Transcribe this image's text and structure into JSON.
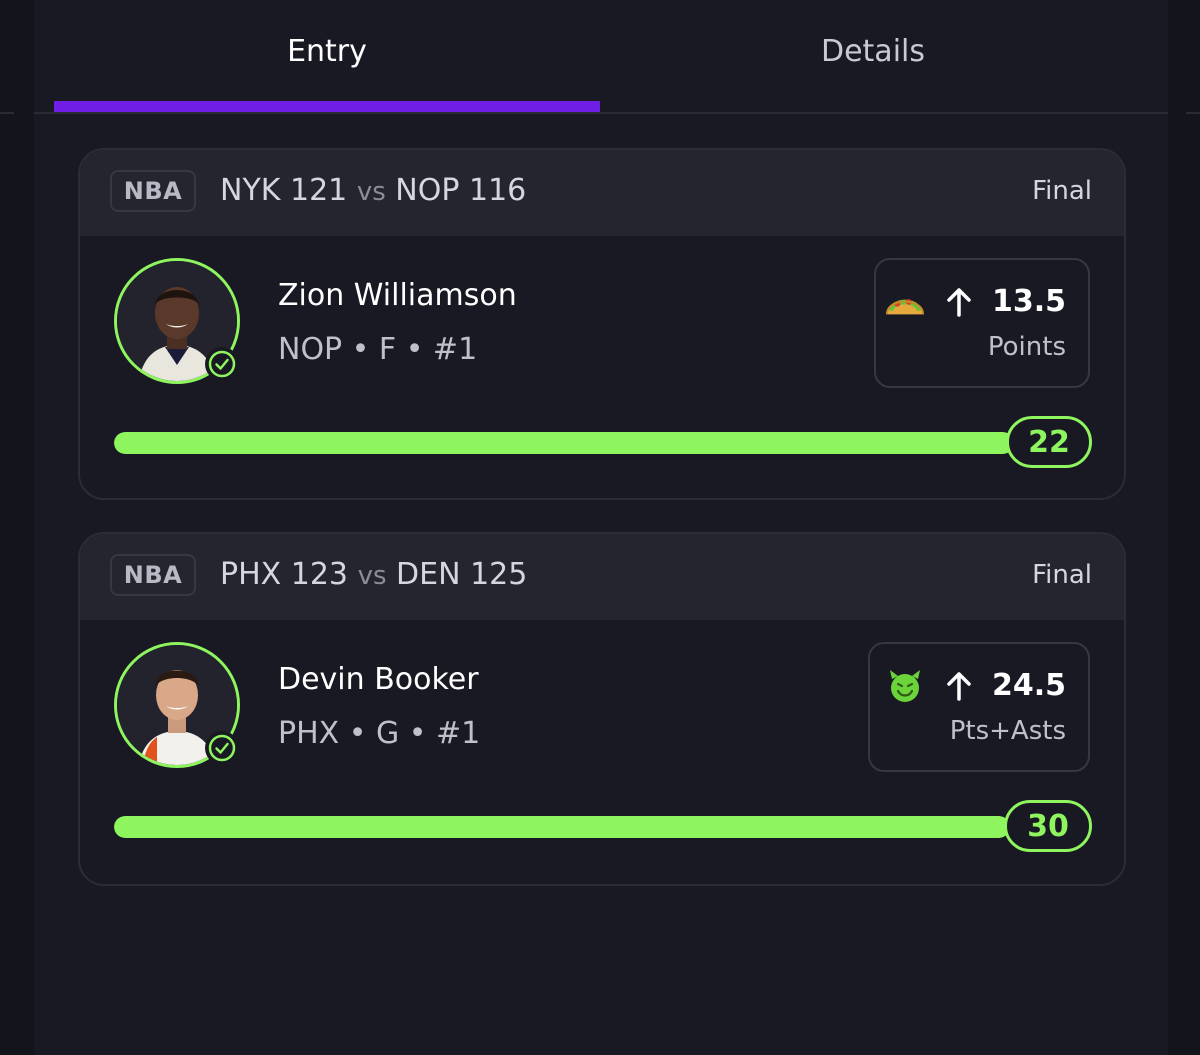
{
  "tabs": [
    {
      "label": "Entry",
      "active": true
    },
    {
      "label": "Details",
      "active": false
    }
  ],
  "accent_color": "#6f1ee6",
  "success_color": "#8ff55f",
  "picks": [
    {
      "league": "NBA",
      "team1": "NYK",
      "score1": "121",
      "vs": "vs",
      "team2": "NOP",
      "score2": "116",
      "status": "Final",
      "player_name": "Zion Williamson",
      "player_meta": "NOP • F • #1",
      "emoji_icon": "taco-emoji-icon",
      "direction_icon": "arrow-up-icon",
      "line": "13.5",
      "stat": "Points",
      "result": "22",
      "progress": 1.0,
      "hit": true
    },
    {
      "league": "NBA",
      "team1": "PHX",
      "score1": "123",
      "vs": "vs",
      "team2": "DEN",
      "score2": "125",
      "status": "Final",
      "player_name": "Devin Booker",
      "player_meta": "PHX • G • #1",
      "emoji_icon": "smiling-devil-emoji-icon",
      "direction_icon": "arrow-up-icon",
      "line": "24.5",
      "stat": "Pts+Asts",
      "result": "30",
      "progress": 1.0,
      "hit": true
    }
  ]
}
